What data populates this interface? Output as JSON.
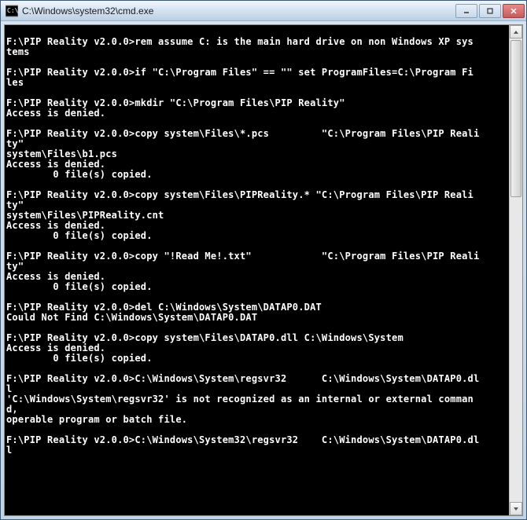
{
  "titlebar": {
    "title": "C:\\Windows\\system32\\cmd.exe"
  },
  "console": {
    "lines": [
      "",
      "F:\\PIP Reality v2.0.0>rem assume C: is the main hard drive on non Windows XP sys",
      "tems",
      "",
      "F:\\PIP Reality v2.0.0>if \"C:\\Program Files\" == \"\" set ProgramFiles=C:\\Program Fi",
      "les",
      "",
      "F:\\PIP Reality v2.0.0>mkdir \"C:\\Program Files\\PIP Reality\"",
      "Access is denied.",
      "",
      "F:\\PIP Reality v2.0.0>copy system\\Files\\*.pcs         \"C:\\Program Files\\PIP Reali",
      "ty\"",
      "system\\Files\\b1.pcs",
      "Access is denied.",
      "        0 file(s) copied.",
      "",
      "F:\\PIP Reality v2.0.0>copy system\\Files\\PIPReality.* \"C:\\Program Files\\PIP Reali",
      "ty\"",
      "system\\Files\\PIPReality.cnt",
      "Access is denied.",
      "        0 file(s) copied.",
      "",
      "F:\\PIP Reality v2.0.0>copy \"!Read Me!.txt\"            \"C:\\Program Files\\PIP Reali",
      "ty\"",
      "Access is denied.",
      "        0 file(s) copied.",
      "",
      "F:\\PIP Reality v2.0.0>del C:\\Windows\\System\\DATAP0.DAT",
      "Could Not Find C:\\Windows\\System\\DATAP0.DAT",
      "",
      "F:\\PIP Reality v2.0.0>copy system\\Files\\DATAP0.dll C:\\Windows\\System",
      "Access is denied.",
      "        0 file(s) copied.",
      "",
      "F:\\PIP Reality v2.0.0>C:\\Windows\\System\\regsvr32      C:\\Windows\\System\\DATAP0.dl",
      "l",
      "'C:\\Windows\\System\\regsvr32' is not recognized as an internal or external comman",
      "d,",
      "operable program or batch file.",
      "",
      "F:\\PIP Reality v2.0.0>C:\\Windows\\System32\\regsvr32    C:\\Windows\\System\\DATAP0.dl",
      "l"
    ]
  }
}
